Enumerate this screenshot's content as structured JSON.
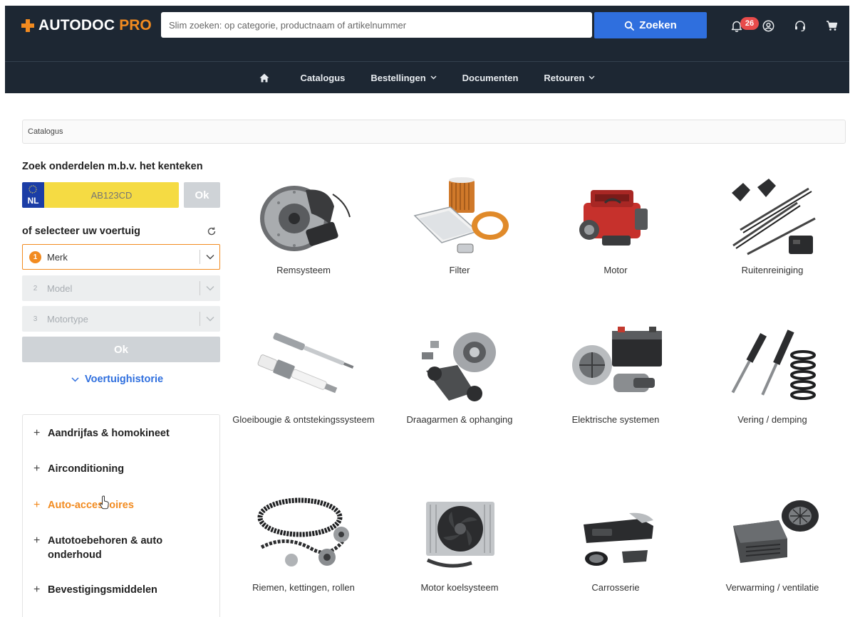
{
  "header": {
    "logo_text": "AUTODOC",
    "logo_suffix": "PRO",
    "search_placeholder": "Slim zoeken: op categorie, productnaam of artikelnummer",
    "search_button": "Zoeken",
    "notifications_count": "26"
  },
  "nav": {
    "items": [
      {
        "label": "Catalogus",
        "has_dropdown": false
      },
      {
        "label": "Bestellingen",
        "has_dropdown": true
      },
      {
        "label": "Documenten",
        "has_dropdown": false
      },
      {
        "label": "Retouren",
        "has_dropdown": true
      }
    ]
  },
  "breadcrumb": "Catalogus",
  "plate_search": {
    "title": "Zoek onderdelen m.b.v. het kenteken",
    "country": "NL",
    "plate_placeholder": "AB123CD",
    "ok_label": "Ok"
  },
  "vehicle_select": {
    "title": "of selecteer uw voertuig",
    "steps": [
      {
        "num": "1",
        "label": "Merk"
      },
      {
        "num": "2",
        "label": "Model"
      },
      {
        "num": "3",
        "label": "Motortype"
      }
    ],
    "ok_label": "Ok",
    "history_label": "Voertuighistorie"
  },
  "categories_sidebar": [
    {
      "label": "Aandrijfas & homokineet",
      "highlighted": false
    },
    {
      "label": "Airconditioning",
      "highlighted": false
    },
    {
      "label": "Auto-accessoires",
      "highlighted": true
    },
    {
      "label": "Autotoebehoren & auto onderhoud",
      "highlighted": false
    },
    {
      "label": "Bevestigingsmiddelen",
      "highlighted": false
    }
  ],
  "catalog": [
    {
      "label": "Remsysteem",
      "icon": "brake-disc-icon"
    },
    {
      "label": "Filter",
      "icon": "filter-icon"
    },
    {
      "label": "Motor",
      "icon": "engine-icon"
    },
    {
      "label": "Ruitenreiniging",
      "icon": "wiper-icon"
    },
    {
      "label": "Gloeibougie & ontstekingssysteem",
      "icon": "spark-plug-icon"
    },
    {
      "label": "Draagarmen & ophanging",
      "icon": "suspension-arm-icon"
    },
    {
      "label": "Elektrische systemen",
      "icon": "battery-icon"
    },
    {
      "label": "Vering / demping",
      "icon": "shock-absorber-icon"
    },
    {
      "label": "Riemen, kettingen, rollen",
      "icon": "timing-belt-icon"
    },
    {
      "label": "Motor koelsysteem",
      "icon": "radiator-icon"
    },
    {
      "label": "Carrosserie",
      "icon": "car-body-icon"
    },
    {
      "label": "Verwarming / ventilatie",
      "icon": "blower-icon"
    }
  ],
  "colors": {
    "header_bg": "#1d2733",
    "accent_orange": "#f28b20",
    "primary_blue": "#2f6fde",
    "plate_yellow": "#f5db43",
    "badge_red": "#e84b4b"
  }
}
